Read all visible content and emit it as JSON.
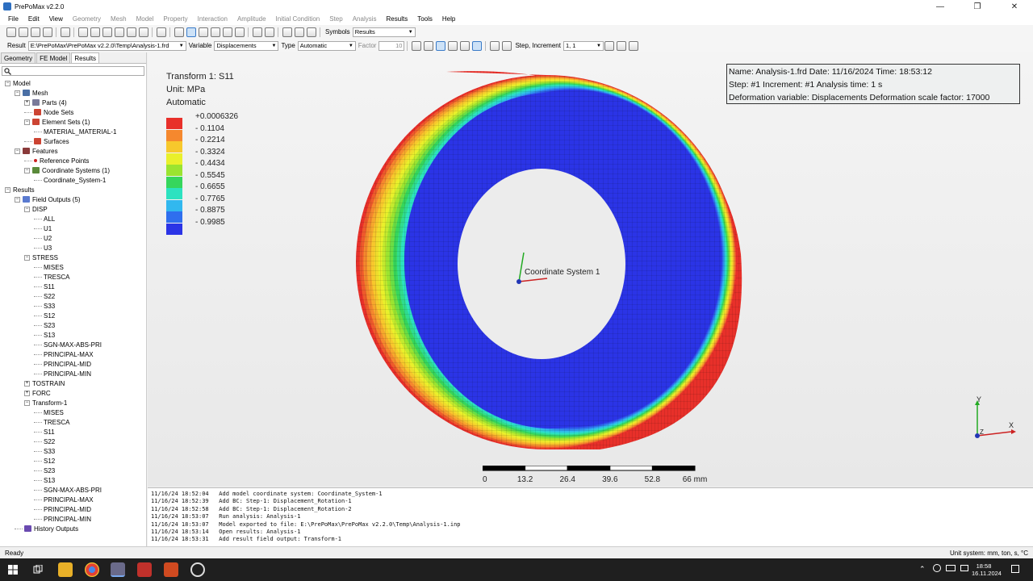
{
  "window": {
    "title": "PrePoMax v2.2.0"
  },
  "menu": [
    {
      "label": "File",
      "enabled": true
    },
    {
      "label": "Edit",
      "enabled": true
    },
    {
      "label": "View",
      "enabled": true
    },
    {
      "label": "Geometry",
      "enabled": false
    },
    {
      "label": "Mesh",
      "enabled": false
    },
    {
      "label": "Model",
      "enabled": false
    },
    {
      "label": "Property",
      "enabled": false
    },
    {
      "label": "Interaction",
      "enabled": false
    },
    {
      "label": "Amplitude",
      "enabled": false
    },
    {
      "label": "Initial Condition",
      "enabled": false
    },
    {
      "label": "Step",
      "enabled": false
    },
    {
      "label": "Analysis",
      "enabled": false
    },
    {
      "label": "Results",
      "enabled": true
    },
    {
      "label": "Tools",
      "enabled": true
    },
    {
      "label": "Help",
      "enabled": true
    }
  ],
  "toolbar1": {
    "symbols_label": "Symbols",
    "symbols_value": "Results"
  },
  "toolbar2": {
    "result_label": "Result",
    "result_value": "E:\\PrePoMax\\PrePoMax v2.2.0\\Temp\\Analysis-1.frd",
    "variable_label": "Variable",
    "variable_value": "Displacements",
    "type_label": "Type",
    "type_value": "Automatic",
    "factor_label": "Factor",
    "factor_value": "10",
    "step_label": "Step, Increment",
    "step_value": "1, 1"
  },
  "tabs": [
    "Geometry",
    "FE Model",
    "Results"
  ],
  "tree": [
    {
      "label": "Model",
      "level": 0,
      "icon": "none",
      "exp": "-"
    },
    {
      "label": "Mesh",
      "level": 1,
      "icon": "mesh",
      "exp": "-"
    },
    {
      "label": "Parts (4)",
      "level": 2,
      "icon": "part",
      "exp": "+"
    },
    {
      "label": "Node Sets",
      "level": 2,
      "icon": "node",
      "exp": ""
    },
    {
      "label": "Element Sets (1)",
      "level": 2,
      "icon": "elem",
      "exp": "-"
    },
    {
      "label": "MATERIAL_MATERIAL-1",
      "level": 3,
      "icon": "none",
      "exp": ""
    },
    {
      "label": "Surfaces",
      "level": 2,
      "icon": "surf",
      "exp": ""
    },
    {
      "label": "Features",
      "level": 1,
      "icon": "feat",
      "exp": "-"
    },
    {
      "label": "Reference Points",
      "level": 2,
      "icon": "ref",
      "exp": ""
    },
    {
      "label": "Coordinate Systems (1)",
      "level": 2,
      "icon": "cs",
      "exp": "-"
    },
    {
      "label": "Coordinate_System-1",
      "level": 3,
      "icon": "none",
      "exp": ""
    },
    {
      "label": "Results",
      "level": 0,
      "icon": "none",
      "exp": "-"
    },
    {
      "label": "Field Outputs (5)",
      "level": 1,
      "icon": "field",
      "exp": "-"
    },
    {
      "label": "DISP",
      "level": 2,
      "icon": "none",
      "exp": "-"
    },
    {
      "label": "ALL",
      "level": 3,
      "icon": "none",
      "exp": ""
    },
    {
      "label": "U1",
      "level": 3,
      "icon": "none",
      "exp": ""
    },
    {
      "label": "U2",
      "level": 3,
      "icon": "none",
      "exp": ""
    },
    {
      "label": "U3",
      "level": 3,
      "icon": "none",
      "exp": ""
    },
    {
      "label": "STRESS",
      "level": 2,
      "icon": "none",
      "exp": "-"
    },
    {
      "label": "MISES",
      "level": 3,
      "icon": "none",
      "exp": ""
    },
    {
      "label": "TRESCA",
      "level": 3,
      "icon": "none",
      "exp": ""
    },
    {
      "label": "S11",
      "level": 3,
      "icon": "none",
      "exp": ""
    },
    {
      "label": "S22",
      "level": 3,
      "icon": "none",
      "exp": ""
    },
    {
      "label": "S33",
      "level": 3,
      "icon": "none",
      "exp": ""
    },
    {
      "label": "S12",
      "level": 3,
      "icon": "none",
      "exp": ""
    },
    {
      "label": "S23",
      "level": 3,
      "icon": "none",
      "exp": ""
    },
    {
      "label": "S13",
      "level": 3,
      "icon": "none",
      "exp": ""
    },
    {
      "label": "SGN-MAX-ABS-PRI",
      "level": 3,
      "icon": "none",
      "exp": ""
    },
    {
      "label": "PRINCIPAL-MAX",
      "level": 3,
      "icon": "none",
      "exp": ""
    },
    {
      "label": "PRINCIPAL-MID",
      "level": 3,
      "icon": "none",
      "exp": ""
    },
    {
      "label": "PRINCIPAL-MIN",
      "level": 3,
      "icon": "none",
      "exp": ""
    },
    {
      "label": "TOSTRAIN",
      "level": 2,
      "icon": "none",
      "exp": "+"
    },
    {
      "label": "FORC",
      "level": 2,
      "icon": "none",
      "exp": "+"
    },
    {
      "label": "Transform-1",
      "level": 2,
      "icon": "none",
      "exp": "-"
    },
    {
      "label": "MISES",
      "level": 3,
      "icon": "none",
      "exp": ""
    },
    {
      "label": "TRESCA",
      "level": 3,
      "icon": "none",
      "exp": ""
    },
    {
      "label": "S11",
      "level": 3,
      "icon": "none",
      "exp": ""
    },
    {
      "label": "S22",
      "level": 3,
      "icon": "none",
      "exp": ""
    },
    {
      "label": "S33",
      "level": 3,
      "icon": "none",
      "exp": ""
    },
    {
      "label": "S12",
      "level": 3,
      "icon": "none",
      "exp": ""
    },
    {
      "label": "S23",
      "level": 3,
      "icon": "none",
      "exp": ""
    },
    {
      "label": "S13",
      "level": 3,
      "icon": "none",
      "exp": ""
    },
    {
      "label": "SGN-MAX-ABS-PRI",
      "level": 3,
      "icon": "none",
      "exp": ""
    },
    {
      "label": "PRINCIPAL-MAX",
      "level": 3,
      "icon": "none",
      "exp": ""
    },
    {
      "label": "PRINCIPAL-MID",
      "level": 3,
      "icon": "none",
      "exp": ""
    },
    {
      "label": "PRINCIPAL-MIN",
      "level": 3,
      "icon": "none",
      "exp": ""
    },
    {
      "label": "History Outputs",
      "level": 1,
      "icon": "hist",
      "exp": ""
    }
  ],
  "legend": {
    "title": "Transform 1: S11",
    "unit": "Unit: MPa",
    "mode": "Automatic",
    "values": [
      "+0.0006326",
      "- 0.1104",
      "- 0.2214",
      "- 0.3324",
      "- 0.4434",
      "- 0.5545",
      "- 0.6655",
      "- 0.7765",
      "- 0.8875",
      "- 0.9985"
    ],
    "colors": [
      "#e8302a",
      "#f5882e",
      "#f7c82c",
      "#e9f02b",
      "#9be430",
      "#36d65c",
      "#2ce2c0",
      "#31b8ef",
      "#2f6fee",
      "#2b34e6"
    ]
  },
  "info": {
    "line1": "Name: Analysis-1.frd   Date: 11/16/2024   Time: 18:53:12",
    "line2": "Step: #1   Increment: #1   Analysis time: 1 s",
    "line3": "Deformation variable: Displacements   Deformation scale factor: 17000"
  },
  "model": {
    "coord_label": "Coordinate System 1",
    "ring_colors": [
      "#e8302a",
      "#ee5a2c",
      "#f5882e",
      "#f6a82d",
      "#f7c82c",
      "#f0dd2c",
      "#e9f02b",
      "#c4ea2e",
      "#9be430",
      "#6bdd44",
      "#36d65c",
      "#30dc8e",
      "#2ce2c0",
      "#2ecdd8",
      "#31b8ef",
      "#3094ef",
      "#2f6fee",
      "#2d52ea",
      "#2b34e6"
    ]
  },
  "scalebar": {
    "ticks": [
      "0",
      "13.2",
      "26.4",
      "39.6",
      "52.8",
      "66 mm"
    ]
  },
  "triad": {
    "x": "X",
    "y": "Y",
    "z": "Z"
  },
  "console": [
    "11/16/24 18:52:04   Add model coordinate system: Coordinate_System-1",
    "11/16/24 18:52:39   Add BC: Step-1: Displacement_Rotation-1",
    "11/16/24 18:52:58   Add BC: Step-1: Displacement_Rotation-2",
    "11/16/24 18:53:07   Run analysis: Analysis-1",
    "11/16/24 18:53:07   Model exported to file: E:\\PrePoMax\\PrePoMax v2.2.0\\Temp\\Analysis-1.inp",
    "11/16/24 18:53:14   Open results: Analysis-1",
    "11/16/24 18:53:31   Add result field output: Transform-1"
  ],
  "status": {
    "left": "Ready",
    "right": "Unit system: mm, ton, s, °C"
  },
  "taskbar": {
    "time": "18:58",
    "date": "16.11.2024"
  }
}
